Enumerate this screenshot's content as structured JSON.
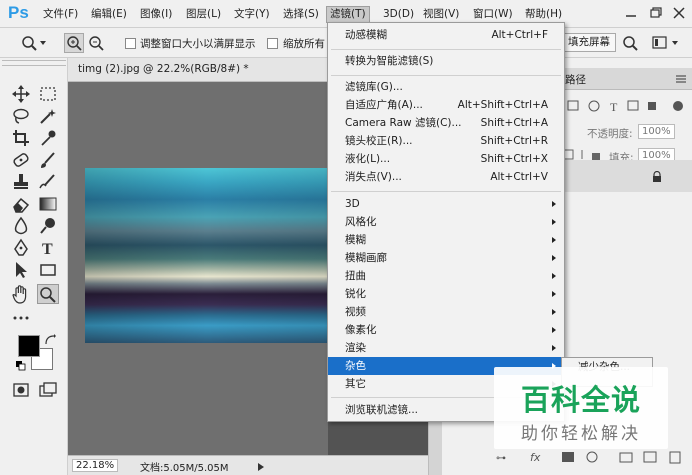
{
  "app": {
    "logo": "Ps"
  },
  "menubar": {
    "items": [
      {
        "label": "文件(F)"
      },
      {
        "label": "编辑(E)"
      },
      {
        "label": "图像(I)"
      },
      {
        "label": "图层(L)"
      },
      {
        "label": "文字(Y)"
      },
      {
        "label": "选择(S)"
      },
      {
        "label": "滤镜(T)",
        "active": true
      },
      {
        "label": "3D(D)"
      },
      {
        "label": "视图(V)"
      },
      {
        "label": "窗口(W)"
      },
      {
        "label": "帮助(H)"
      }
    ],
    "window_controls": [
      "minimize-icon",
      "restore-icon",
      "close-icon"
    ]
  },
  "options_bar": {
    "resize_windows_label": "调整窗口大小以满屏显示",
    "zoom_all_label": "缩放所有",
    "fill_screen_label": "填充屏幕"
  },
  "document": {
    "tab_title": "timg (2).jpg @ 22.2%(RGB/8#) *",
    "zoom": "22.18%",
    "doc_info": "文档:5.05M/5.05M"
  },
  "panel": {
    "tab_path": "路径",
    "opacity_label": "不透明度:",
    "opacity_value": "100%",
    "fill_label": "填充:",
    "fill_value": "100%"
  },
  "filter_menu": {
    "top_items": [
      {
        "label": "动感模糊",
        "shortcut": "Alt+Ctrl+F"
      }
    ],
    "smart_items": [
      {
        "label": "转换为智能滤镜(S)",
        "shortcut": ""
      }
    ],
    "gallery_items": [
      {
        "label": "滤镜库(G)...",
        "shortcut": ""
      },
      {
        "label": "自适应广角(A)...",
        "shortcut": "Alt+Shift+Ctrl+A"
      },
      {
        "label": "Camera Raw 滤镜(C)...",
        "shortcut": "Shift+Ctrl+A"
      },
      {
        "label": "镜头校正(R)...",
        "shortcut": "Shift+Ctrl+R"
      },
      {
        "label": "液化(L)...",
        "shortcut": "Shift+Ctrl+X"
      },
      {
        "label": "消失点(V)...",
        "shortcut": "Alt+Ctrl+V"
      }
    ],
    "sub_items": [
      {
        "label": "3D",
        "highlighted": false
      },
      {
        "label": "风格化",
        "highlighted": false
      },
      {
        "label": "模糊",
        "highlighted": false
      },
      {
        "label": "模糊画廊",
        "highlighted": false
      },
      {
        "label": "扭曲",
        "highlighted": false
      },
      {
        "label": "锐化",
        "highlighted": false
      },
      {
        "label": "视频",
        "highlighted": false
      },
      {
        "label": "像素化",
        "highlighted": false
      },
      {
        "label": "渲染",
        "highlighted": false
      },
      {
        "label": "杂色",
        "highlighted": true
      },
      {
        "label": "其它",
        "highlighted": false
      }
    ],
    "browse_items": [
      {
        "label": "浏览联机滤镜..."
      }
    ]
  },
  "submenu": {
    "first_item": "减少杂色..."
  },
  "watermark": {
    "title": "百科全说",
    "subtitle": "助你轻松解决"
  },
  "colors": {
    "accent": "#1a6fc9",
    "ps_blue": "#2d9be6",
    "watermark_green": "#1aa35a"
  }
}
